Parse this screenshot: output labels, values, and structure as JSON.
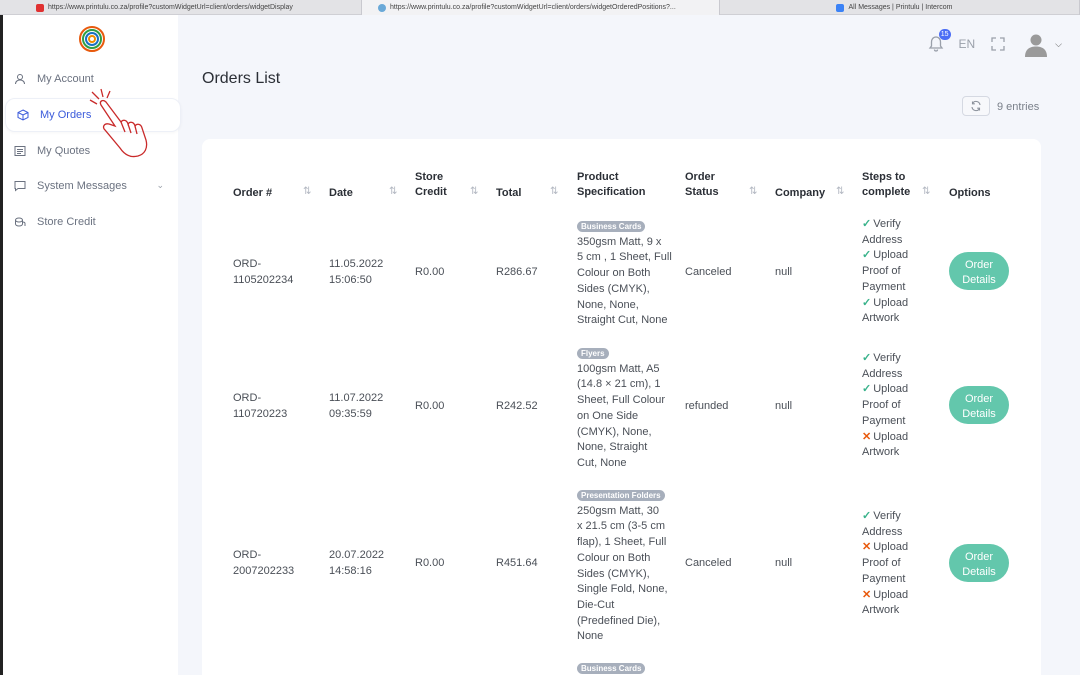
{
  "browser": {
    "tabs": [
      {
        "title": "https://www.printulu.co.za/profile?customWidgetUrl=client/orders/widgetDisplay",
        "favicon_color": "#e03131"
      },
      {
        "title": "https://www.printulu.co.za/profile?customWidgetUrl=client/orders/widgetOrderedPositions?...",
        "favicon_color": "#6aa9d8"
      },
      {
        "title": "All Messages | Printulu | Intercom",
        "favicon_color": "#3b82f6"
      }
    ]
  },
  "sidebar": {
    "items": [
      {
        "label": "My Account",
        "icon": "user-icon"
      },
      {
        "label": "My Orders",
        "icon": "box-icon"
      },
      {
        "label": "My Quotes",
        "icon": "quote-icon"
      },
      {
        "label": "System Messages",
        "icon": "chat-icon"
      },
      {
        "label": "Store Credit",
        "icon": "coins-icon"
      }
    ]
  },
  "topbar": {
    "notification_count": "15",
    "language": "EN"
  },
  "page": {
    "title": "Orders List",
    "entries": "9 entries"
  },
  "table": {
    "headers": {
      "order": "Order #",
      "date": "Date",
      "credit_1": "Store",
      "credit_2": "Credit",
      "total": "Total",
      "spec_1": "Product",
      "spec_2": "Specification",
      "status_1": "Order",
      "status_2": "Status",
      "company": "Company",
      "steps_1": "Steps to",
      "steps_2": "complete",
      "options": "Options"
    },
    "rows": [
      {
        "order_1": "ORD-",
        "order_2": "1105202234",
        "date_1": "11.05.2022",
        "date_2": "15:06:50",
        "credit": "R0.00",
        "total": "R286.67",
        "tag": "Business Cards",
        "spec_lines": [
          "350gsm Matt, 9 x",
          "5 cm , 1 Sheet, Full",
          "Colour on Both",
          "Sides (CMYK),",
          "None, None,",
          "Straight Cut, None"
        ],
        "status": "Canceled",
        "company": "null",
        "steps": [
          {
            "mark": "✓",
            "l1": "Verify",
            "l2": "Address"
          },
          {
            "mark": "✓",
            "l1": "Upload",
            "l2": "Proof of",
            "l3": "Payment"
          },
          {
            "mark": "✓",
            "l1": "Upload",
            "l2": "Artwork"
          }
        ],
        "button_1": "Order",
        "button_2": "Details"
      },
      {
        "order_1": "ORD-",
        "order_2": "110720223",
        "date_1": "11.07.2022",
        "date_2": "09:35:59",
        "credit": "R0.00",
        "total": "R242.52",
        "tag": "Flyers",
        "spec_lines": [
          "100gsm Matt, A5",
          "(14.8 × 21 cm), 1",
          "Sheet, Full Colour",
          "on One Side",
          "(CMYK), None,",
          "None, Straight",
          "Cut, None"
        ],
        "status": "refunded",
        "company": "null",
        "steps": [
          {
            "mark": "✓",
            "l1": "Verify",
            "l2": "Address"
          },
          {
            "mark": "✓",
            "l1": "Upload",
            "l2": "Proof of",
            "l3": "Payment"
          },
          {
            "mark": "✕",
            "l1": "Upload",
            "l2": "Artwork"
          }
        ],
        "button_1": "Order",
        "button_2": "Details"
      },
      {
        "order_1": "ORD-",
        "order_2": "2007202233",
        "date_1": "20.07.2022",
        "date_2": "14:58:16",
        "credit": "R0.00",
        "total": "R451.64",
        "tag": "Presentation Folders",
        "spec_lines": [
          "250gsm Matt, 30",
          "x 21.5 cm (3-5 cm",
          "flap), 1 Sheet, Full",
          "Colour on Both",
          "Sides (CMYK),",
          "Single Fold, None,",
          "Die-Cut",
          "(Predefined Die),",
          "None"
        ],
        "status": "Canceled",
        "company": "null",
        "steps": [
          {
            "mark": "✓",
            "l1": "Verify",
            "l2": "Address"
          },
          {
            "mark": "✕",
            "l1": "Upload",
            "l2": "Proof of",
            "l3": "Payment"
          },
          {
            "mark": "✕",
            "l1": "Upload",
            "l2": "Artwork"
          }
        ],
        "button_1": "Order",
        "button_2": "Details"
      },
      {
        "tag": "Business Cards"
      }
    ]
  }
}
